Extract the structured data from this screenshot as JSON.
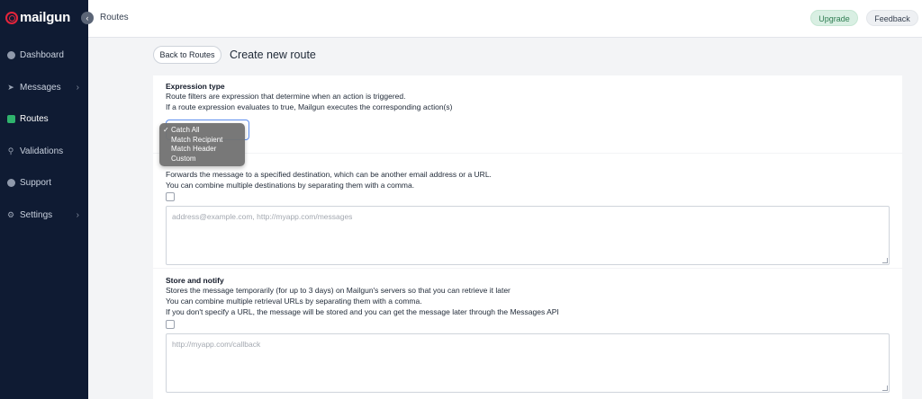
{
  "app": {
    "logo_text": "mailgun",
    "brand_color": "#e5243b"
  },
  "sidebar": {
    "collapse_icon": "‹",
    "items": [
      {
        "label": "Dashboard",
        "icon": "dashboard-icon",
        "has_chevron": false
      },
      {
        "label": "Messages",
        "icon": "send-icon",
        "has_chevron": true
      },
      {
        "label": "Routes",
        "icon": "routes-icon",
        "has_chevron": false,
        "active": true
      },
      {
        "label": "Validations",
        "icon": "validations-icon",
        "has_chevron": false
      },
      {
        "label": "Support",
        "icon": "support-icon",
        "has_chevron": false
      },
      {
        "label": "Settings",
        "icon": "gear-icon",
        "has_chevron": true
      }
    ],
    "chevron": "›"
  },
  "header": {
    "breadcrumb": "Routes",
    "upgrade_label": "Upgrade",
    "feedback_label": "Feedback"
  },
  "main": {
    "back_label": "Back to Routes",
    "title": "Create new route",
    "expression": {
      "title": "Expression type",
      "line1": "Route filters are expression that determine when an action is triggered.",
      "line2": "If a route expression evaluates to true, Mailgun executes the corresponding action(s)",
      "options": [
        "Catch All",
        "Match Recipient",
        "Match Header",
        "Custom"
      ],
      "selected": "Catch All",
      "check": "✓"
    },
    "forward": {
      "line1": "Forwards the message to a specified destination, which can be another email address or a URL.",
      "line2": "You can combine multiple destinations by separating them with a comma.",
      "placeholder": "address@example.com, http://myapp.com/messages"
    },
    "store": {
      "title": "Store and notify",
      "line1": "Stores the message temporarily (for up to 3 days) on Mailgun's servers so that you can retrieve it later",
      "line2": "You can combine multiple retrieval URLs by separating them with a comma.",
      "line3": "If you don't specify a URL, the message will be stored and you can get the message later through the Messages API",
      "placeholder": "http://myapp.com/callback"
    }
  }
}
